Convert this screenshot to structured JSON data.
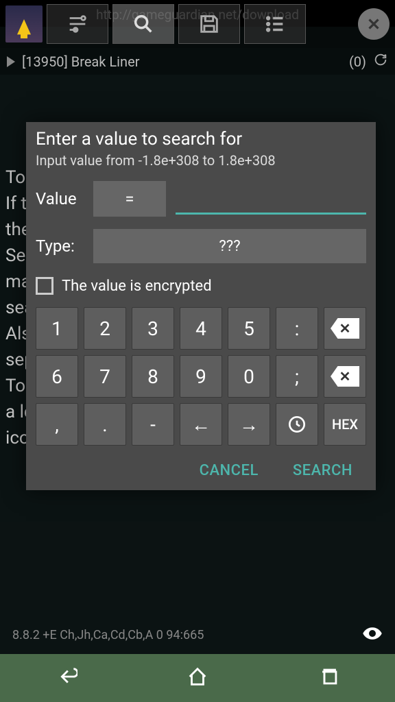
{
  "url": "http://gameguardian.net/download",
  "process": {
    "label": "[13950] Break Liner",
    "count": "(0)"
  },
  "bg_text": "To\nIf t\nthe\nSea\nma\nsea\nAls\nsep\nTo\na lc\nico",
  "dialog": {
    "title": "Enter a value to search for",
    "subtitle": "Input value from -1.8e+308 to 1.8e+308",
    "value_label": "Value",
    "eq": "=",
    "value_input": "",
    "type_label": "Type:",
    "type_value": "???",
    "encrypted_label": "The value is encrypted",
    "cancel": "CANCEL",
    "search": "SEARCH"
  },
  "keypad": {
    "r1": [
      "1",
      "2",
      "3",
      "4",
      "5",
      ":"
    ],
    "r2": [
      "6",
      "7",
      "8",
      "9",
      "0",
      ";"
    ],
    "r3": [
      ",",
      ".",
      "-",
      "←",
      "→"
    ],
    "hex": "HEX"
  },
  "footer": "8.8.2   +E Ch,Jh,Ca,Cd,Cb,A   0  94:665"
}
